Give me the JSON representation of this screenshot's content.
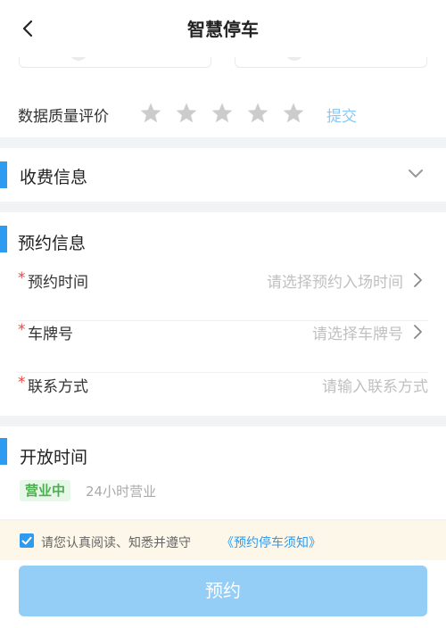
{
  "nav": {
    "title": "智慧停车",
    "back_icon": "chevron-left-icon"
  },
  "rating": {
    "label": "数据质量评价",
    "stars_total": 5,
    "stars_selected": 0,
    "star_icon": "star-icon",
    "submit_label": "提交"
  },
  "fee": {
    "title": "收费信息",
    "toggle_icon": "chevron-down-icon"
  },
  "reservation": {
    "title": "预约信息",
    "required_mark": "*",
    "rows": [
      {
        "label": "预约时间",
        "placeholder": "请选择预约入场时间",
        "arrow_icon": "chevron-right-icon"
      },
      {
        "label": "车牌号",
        "placeholder": "请选择车牌号",
        "arrow_icon": "chevron-right-icon"
      },
      {
        "label": "联系方式",
        "placeholder": "请输入联系方式"
      }
    ]
  },
  "open_hours": {
    "title": "开放时间",
    "status_badge": "营业中",
    "hours": "24小时营业"
  },
  "agreement": {
    "checked": true,
    "text": "请您认真阅读、知悉并遵守",
    "link": "《预约停车须知》"
  },
  "footer": {
    "submit_label": "预约"
  },
  "colors": {
    "accent": "#2c9bf0",
    "button_disabled": "#94cdf6",
    "required": "#e84545",
    "status_green": "#4caf50",
    "star_inactive": "#cccccc"
  }
}
